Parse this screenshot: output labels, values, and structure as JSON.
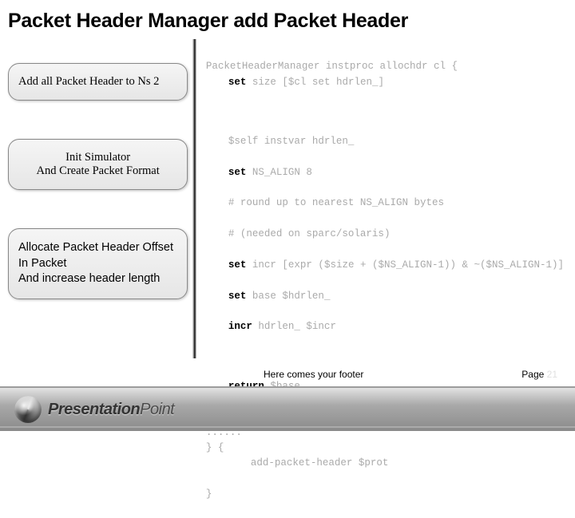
{
  "title": "Packet Header Manager add Packet Header",
  "boxes": {
    "b1": "Add all Packet Header to Ns 2",
    "b2_line1": "Init Simulator",
    "b2_line2": "And Create Packet Format",
    "b3_line1": "Allocate Packet Header Offset",
    "b3_line2": "In Packet",
    "b3_line3": "And increase header length"
  },
  "code": {
    "l1a": "PacketHeaderManager instproc allochdr cl {",
    "l2_kw": "set",
    "l2_rest": " size [$cl set hdrlen_]",
    "l3": "$self instvar hdrlen_",
    "l4_kw": "set",
    "l4_rest": " NS_ALIGN 8",
    "l5": "# round up to nearest NS_ALIGN bytes",
    "l6": "# (needed on sparc/solaris)",
    "l7_kw": "set",
    "l7_rest": " incr [expr ($size + ($NS_ALIGN-1)) & ~($NS_ALIGN-1)]",
    "l8_kw": "set",
    "l8_rest": " base $hdrlen_",
    "l9_kw": "incr",
    "l9_rest": " hdrlen_ $incr",
    "l10_kw": "return",
    "l10_rest": " $base",
    "l11": "}",
    "l12": "......",
    "l13": "} {",
    "l14": "add-packet-header $prot",
    "l15": "}"
  },
  "logo": {
    "bold": "Presentation",
    "light": "Point"
  },
  "footer": {
    "center": "Here comes your footer",
    "page_label": "Page",
    "page_num": "21"
  }
}
